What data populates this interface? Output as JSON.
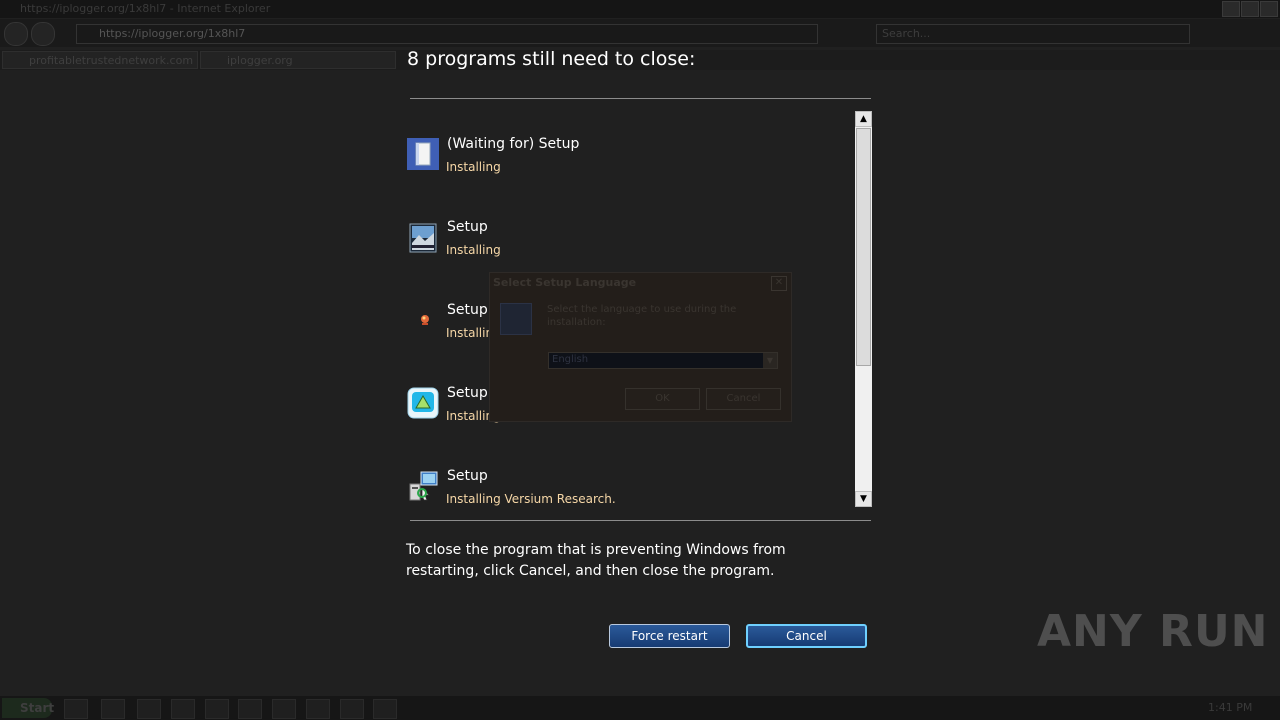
{
  "browser": {
    "window_title": "https://iplogger.org/1x8hl7 - Internet Explorer",
    "address": "https://iplogger.org/1x8hl7",
    "search_placeholder": "Search...",
    "tabs": [
      {
        "label": "profitabletrustednetwork.com"
      },
      {
        "label": "iplogger.org"
      }
    ]
  },
  "restart_dialog": {
    "title": "8 programs still need to close:",
    "programs": [
      {
        "name": "(Waiting for) Setup",
        "status": "Installing",
        "icon": "setup-document-icon"
      },
      {
        "name": "Setup",
        "status": "Installing",
        "icon": "setup-landscape-icon"
      },
      {
        "name": "Setup",
        "status": "Installing",
        "icon": "setup-small-bug-icon"
      },
      {
        "name": "Setup",
        "status": "Installing",
        "icon": "setup-triangle-icon"
      },
      {
        "name": "Setup",
        "status": "Installing Versium Research.",
        "icon": "setup-installer-icon"
      }
    ],
    "message": "To close the program that is preventing Windows from restarting, click Cancel, and then close the program.",
    "force_restart_label": "Force restart",
    "cancel_label": "Cancel"
  },
  "language_dialog": {
    "title": "Select Setup Language",
    "message": "Select the language to use during the installation:",
    "selected_language": "English",
    "ok_label": "OK",
    "cancel_label": "Cancel"
  },
  "taskbar": {
    "start_label": "Start",
    "clock": "1:41 PM"
  },
  "watermark": "ANY RUN"
}
